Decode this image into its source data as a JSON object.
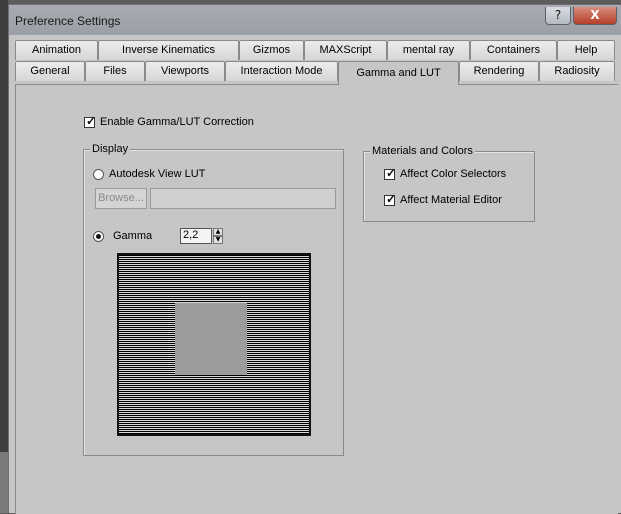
{
  "window": {
    "title": "Preference Settings",
    "buttons": {
      "help": "?",
      "close": "X"
    }
  },
  "tabs": {
    "row1": [
      "Animation",
      "Inverse Kinematics",
      "Gizmos",
      "MAXScript",
      "mental ray",
      "Containers",
      "Help"
    ],
    "row2": [
      "General",
      "Files",
      "Viewports",
      "Interaction Mode",
      "Gamma and LUT",
      "Rendering",
      "Radiosity"
    ],
    "active": "Gamma and LUT"
  },
  "gamma_lut": {
    "enable_label": "Enable Gamma/LUT Correction",
    "enable_checked": true,
    "display": {
      "legend": "Display",
      "autodesk_lut_label": "Autodesk View LUT",
      "browse_label": "Browse...",
      "gamma_label": "Gamma",
      "gamma_value": "2,2"
    },
    "materials": {
      "legend": "Materials and Colors",
      "affect_color_selectors": "Affect Color Selectors",
      "affect_material_editor": "Affect Material Editor"
    }
  }
}
